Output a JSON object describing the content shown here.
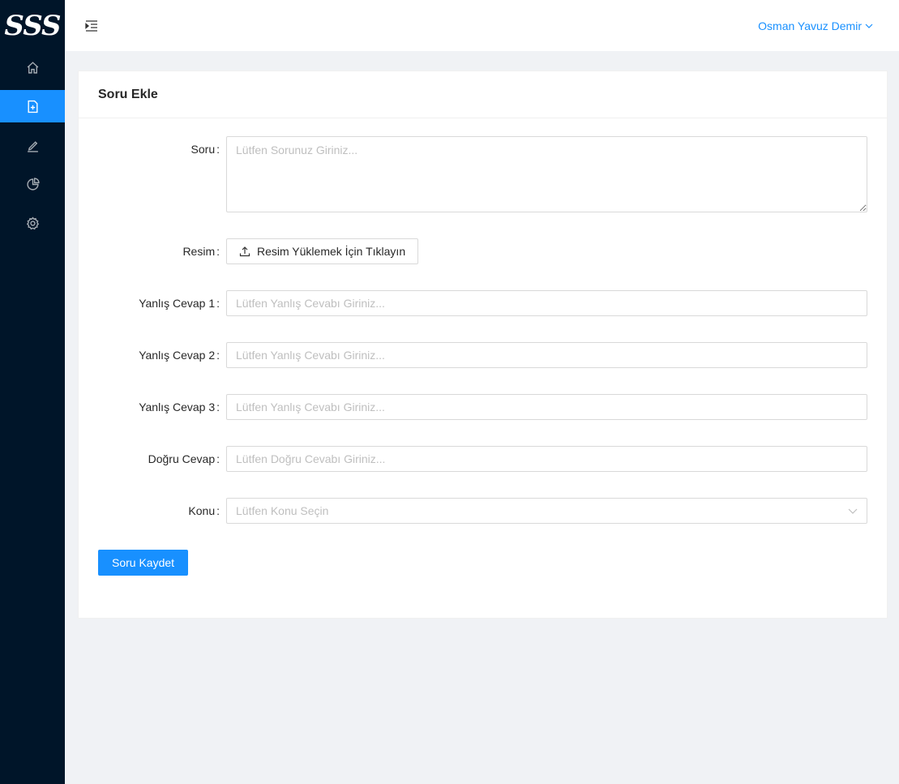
{
  "app": {
    "logo_text": "SSS"
  },
  "sidebar": {
    "items": [
      {
        "icon": "home-icon",
        "active": false
      },
      {
        "icon": "file-add-icon",
        "active": true
      },
      {
        "icon": "edit-icon",
        "active": false
      },
      {
        "icon": "pie-chart-icon",
        "active": false
      },
      {
        "icon": "settings-icon",
        "active": false
      }
    ]
  },
  "header": {
    "user_name": "Osman Yavuz Demir"
  },
  "card": {
    "title": "Soru Ekle"
  },
  "form": {
    "question": {
      "label": "Soru",
      "placeholder": "Lütfen Sorunuz Giriniz..."
    },
    "image": {
      "label": "Resim",
      "button": "Resim Yüklemek İçin Tıklayın"
    },
    "wrong1": {
      "label": "Yanlış Cevap 1",
      "placeholder": "Lütfen Yanlış Cevabı Giriniz..."
    },
    "wrong2": {
      "label": "Yanlış Cevap 2",
      "placeholder": "Lütfen Yanlış Cevabı Giriniz..."
    },
    "wrong3": {
      "label": "Yanlış Cevap 3",
      "placeholder": "Lütfen Yanlış Cevabı Giriniz..."
    },
    "correct": {
      "label": "Doğru Cevap",
      "placeholder": "Lütfen Doğru Cevabı Giriniz..."
    },
    "topic": {
      "label": "Konu",
      "placeholder": "Lütfen Konu Seçin"
    },
    "colon": ":",
    "submit": "Soru Kaydet"
  },
  "colors": {
    "sidebar_bg": "#001529",
    "accent": "#1890ff",
    "page_bg": "#f0f2f5"
  }
}
